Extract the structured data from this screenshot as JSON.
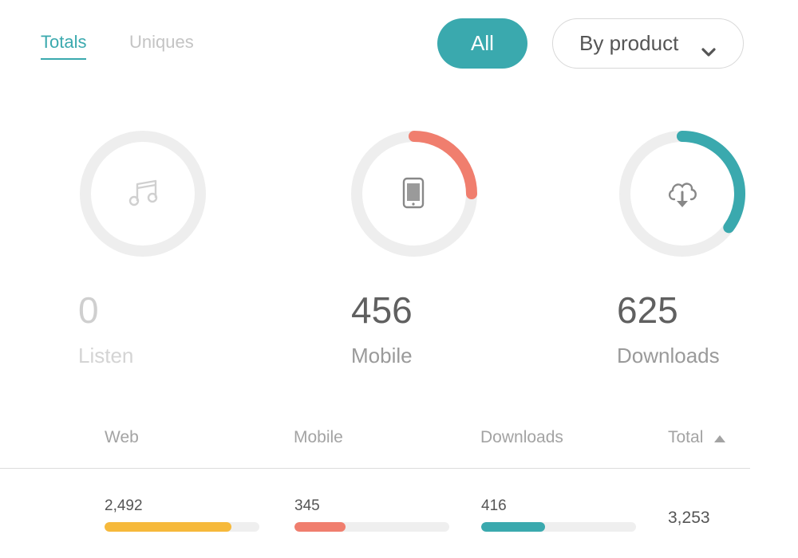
{
  "tabs": [
    {
      "label": "Totals",
      "active": true
    },
    {
      "label": "Uniques",
      "active": false
    }
  ],
  "filter": {
    "all_label": "All",
    "product_label": "By product",
    "accent": "#3aa9ae"
  },
  "stats": [
    {
      "label": "Listen",
      "value": "0",
      "icon": "music-note-icon",
      "fraction": 0,
      "color": "#eeeeee"
    },
    {
      "label": "Mobile",
      "value": "456",
      "icon": "phone-icon",
      "fraction": 0.25,
      "color": "#f07e6e"
    },
    {
      "label": "Downloads",
      "value": "625",
      "icon": "cloud-download-icon",
      "fraction": 0.35,
      "color": "#3aa9ae"
    }
  ],
  "table": {
    "columns": [
      "Web",
      "Mobile",
      "Downloads",
      "Total"
    ],
    "sort": {
      "column": "Total",
      "direction": "ascending"
    },
    "rows": [
      {
        "web": {
          "value": "2,492",
          "fraction": 0.82,
          "color": "#f6b93b"
        },
        "mobile": {
          "value": "345",
          "fraction": 0.33,
          "color": "#f07e6e"
        },
        "downloads": {
          "value": "416",
          "fraction": 0.41,
          "color": "#3aa9ae"
        },
        "total": "3,253"
      }
    ]
  }
}
